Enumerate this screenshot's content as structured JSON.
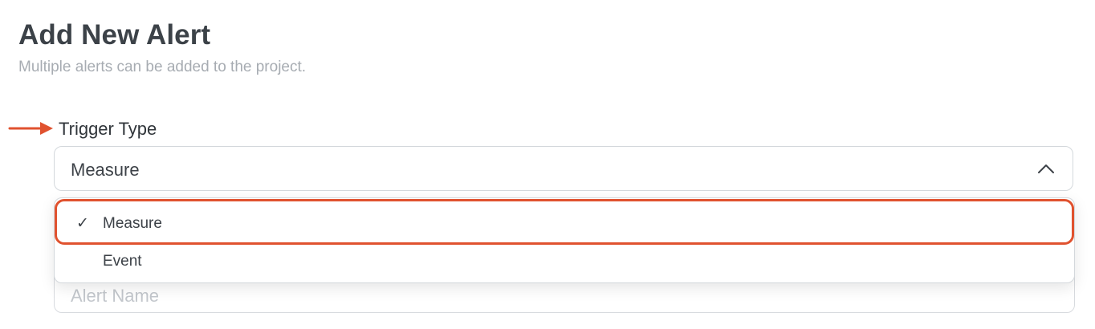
{
  "header": {
    "title": "Add New Alert",
    "subtitle": "Multiple alerts can be added to the project."
  },
  "trigger_type": {
    "label": "Trigger Type",
    "selected_value": "Measure",
    "expanded": true,
    "options": [
      {
        "label": "Measure",
        "selected": true,
        "check_glyph": "✓"
      },
      {
        "label": "Event",
        "selected": false
      }
    ]
  },
  "alert_name": {
    "placeholder": "Alert Name",
    "value": ""
  },
  "annotation": {
    "arrow_icon": "right-arrow-icon",
    "highlight_target": "Measure",
    "color": "#e0522f"
  },
  "colors": {
    "title": "#3c4248",
    "subtitle": "#a7acb2",
    "border": "#d4d8dc",
    "accent": "#e0522f"
  }
}
